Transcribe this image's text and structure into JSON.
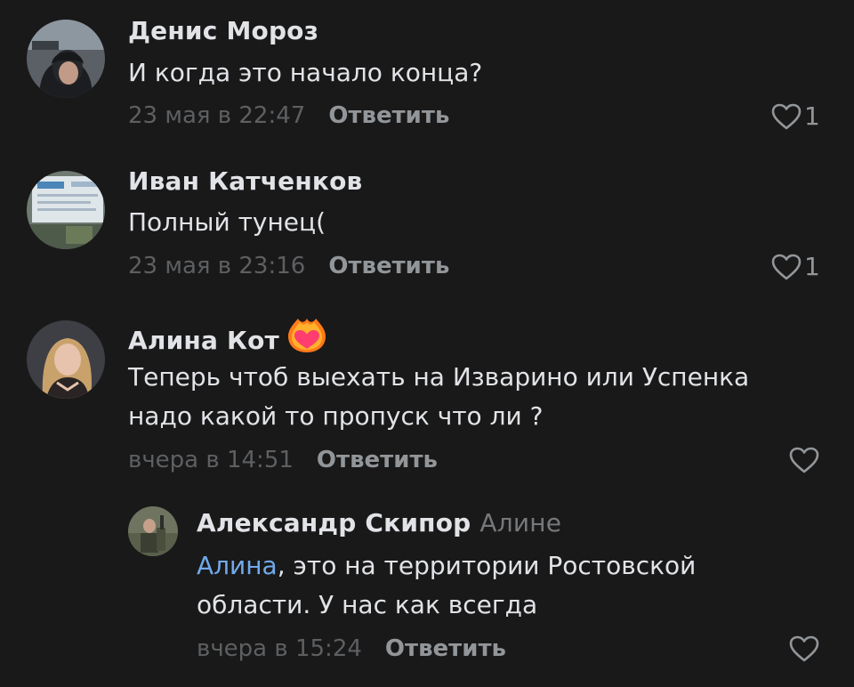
{
  "comments": [
    {
      "author": "Денис Мороз",
      "text": "И когда это начало конца?",
      "date": "23 мая в 22:47",
      "reply_label": "Ответить",
      "likes": "1"
    },
    {
      "author": "Иван Катченков",
      "text": "Полный тунец(",
      "date": "23 мая в 23:16",
      "reply_label": "Ответить",
      "likes": "1"
    },
    {
      "author": "Алина Кот",
      "text_line1": "Теперь чтоб выехать на Изварино или Успенка",
      "text_line2": "надо какой то пропуск что ли ?",
      "date": "вчера в 14:51",
      "reply_label": "Ответить"
    }
  ],
  "reply": {
    "author": "Александр Скипор",
    "reply_to": "Алине",
    "mention": "Алина",
    "text_line1_rest": ", это на территории Ростовской",
    "text_line2": "области. У нас как всегда",
    "date": "вчера в 15:24",
    "reply_label": "Ответить"
  },
  "colors": {
    "background": "#19191a",
    "text_primary": "#e1e3e6",
    "text_secondary": "#939699",
    "date": "#5d5f61",
    "link": "#71aaeb",
    "badge": "#ff3d6e"
  },
  "icons": [
    "heart-outline-icon",
    "fire-heart-badge-icon"
  ]
}
